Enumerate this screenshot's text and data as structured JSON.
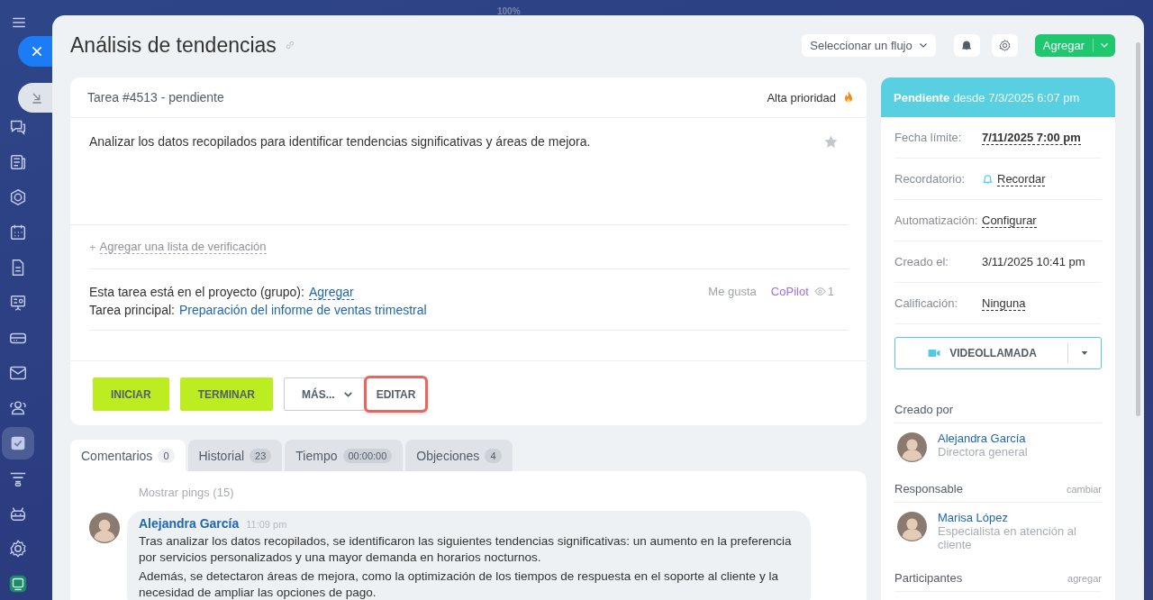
{
  "zoom_label": "100%",
  "sidebar": {
    "items": [
      {
        "kind": "chat",
        "selected": false
      },
      {
        "kind": "news",
        "selected": false
      },
      {
        "kind": "hexagon",
        "selected": false
      },
      {
        "kind": "calendar",
        "selected": false
      },
      {
        "kind": "document",
        "selected": false
      },
      {
        "kind": "board",
        "selected": false
      },
      {
        "kind": "drive",
        "selected": false
      },
      {
        "kind": "mail",
        "selected": false
      },
      {
        "kind": "people",
        "selected": false
      },
      {
        "kind": "tasks",
        "selected": true
      },
      {
        "kind": "funnel",
        "selected": false
      },
      {
        "kind": "robot",
        "selected": false
      },
      {
        "kind": "settings",
        "selected": false
      },
      {
        "kind": "app",
        "selected": false
      }
    ]
  },
  "title": "Análisis de tendencias",
  "toolbar": {
    "flow_select": "Seleccionar un flujo",
    "add_button": "Agregar"
  },
  "task": {
    "header": "Tarea #4513 - pendiente",
    "priority": "Alta prioridad",
    "description": "Analizar los datos recopilados para identificar tendencias significativas y áreas de mejora.",
    "starred": false,
    "checklist_plus": "+",
    "checklist_link": "Agregar una lista de verificación",
    "project_label": "Esta tarea está en el proyecto (grupo):",
    "project_link": "Agregar",
    "parent_label": "Tarea principal:",
    "parent_link": "Preparación del informe de ventas trimestral",
    "like": "Me gusta",
    "copilot": "CoPilot",
    "views": "1",
    "buttons": [
      {
        "label": "INICIAR",
        "kind": "primary",
        "highlighted": false
      },
      {
        "label": "TERMINAR",
        "kind": "primary",
        "highlighted": false
      },
      {
        "label": "MÁS...",
        "kind": "dropdown",
        "highlighted": false
      },
      {
        "label": "EDITAR",
        "kind": "plain",
        "highlighted": true
      }
    ]
  },
  "tabs": [
    {
      "label": "Comentarios",
      "count": "0",
      "selected": true
    },
    {
      "label": "Historial",
      "count": "23",
      "selected": false
    },
    {
      "label": "Tiempo",
      "count": "00:00:00",
      "selected": false
    },
    {
      "label": "Objeciones",
      "count": "4",
      "selected": false
    }
  ],
  "comments": {
    "show_pings": "Mostrar pings (15)",
    "items": [
      {
        "author": "Alejandra García",
        "time": "11:09 pm",
        "paragraphs": [
          "Tras analizar los datos recopilados, se identificaron las siguientes tendencias significativas: un aumento en la preferencia por servicios personalizados y una mayor demanda en horarios nocturnos.",
          "Además, se detectaron áreas de mejora, como la optimización de los tiempos de respuesta en el soporte al cliente y la necesidad de ampliar las opciones de pago."
        ]
      }
    ]
  },
  "status": {
    "state": "Pendiente",
    "since": "desde 7/3/2025 6:07 pm"
  },
  "fields": [
    {
      "label": "Fecha límite:",
      "value": "7/11/2025 7:00 pm",
      "kind": "date"
    },
    {
      "label": "Recordatorio:",
      "value": "Recordar",
      "kind": "reminder"
    },
    {
      "label": "Automatización:",
      "value": "Configurar",
      "kind": "link"
    },
    {
      "label": "Creado el:",
      "value": "3/11/2025 10:41 pm",
      "kind": "text"
    },
    {
      "label": "Calificación:",
      "value": "Ninguna",
      "kind": "link"
    }
  ],
  "video_call": "VIDEOLLAMADA",
  "people_sections": [
    {
      "title": "Creado por",
      "people": [
        {
          "name": "Alejandra García",
          "role": "Directora general"
        }
      ]
    },
    {
      "title": "Responsable",
      "action": "cambiar",
      "people": [
        {
          "name": "Marisa López",
          "role": "Especialista en atención al cliente"
        }
      ]
    },
    {
      "title": "Participantes",
      "action": "agregar"
    }
  ]
}
